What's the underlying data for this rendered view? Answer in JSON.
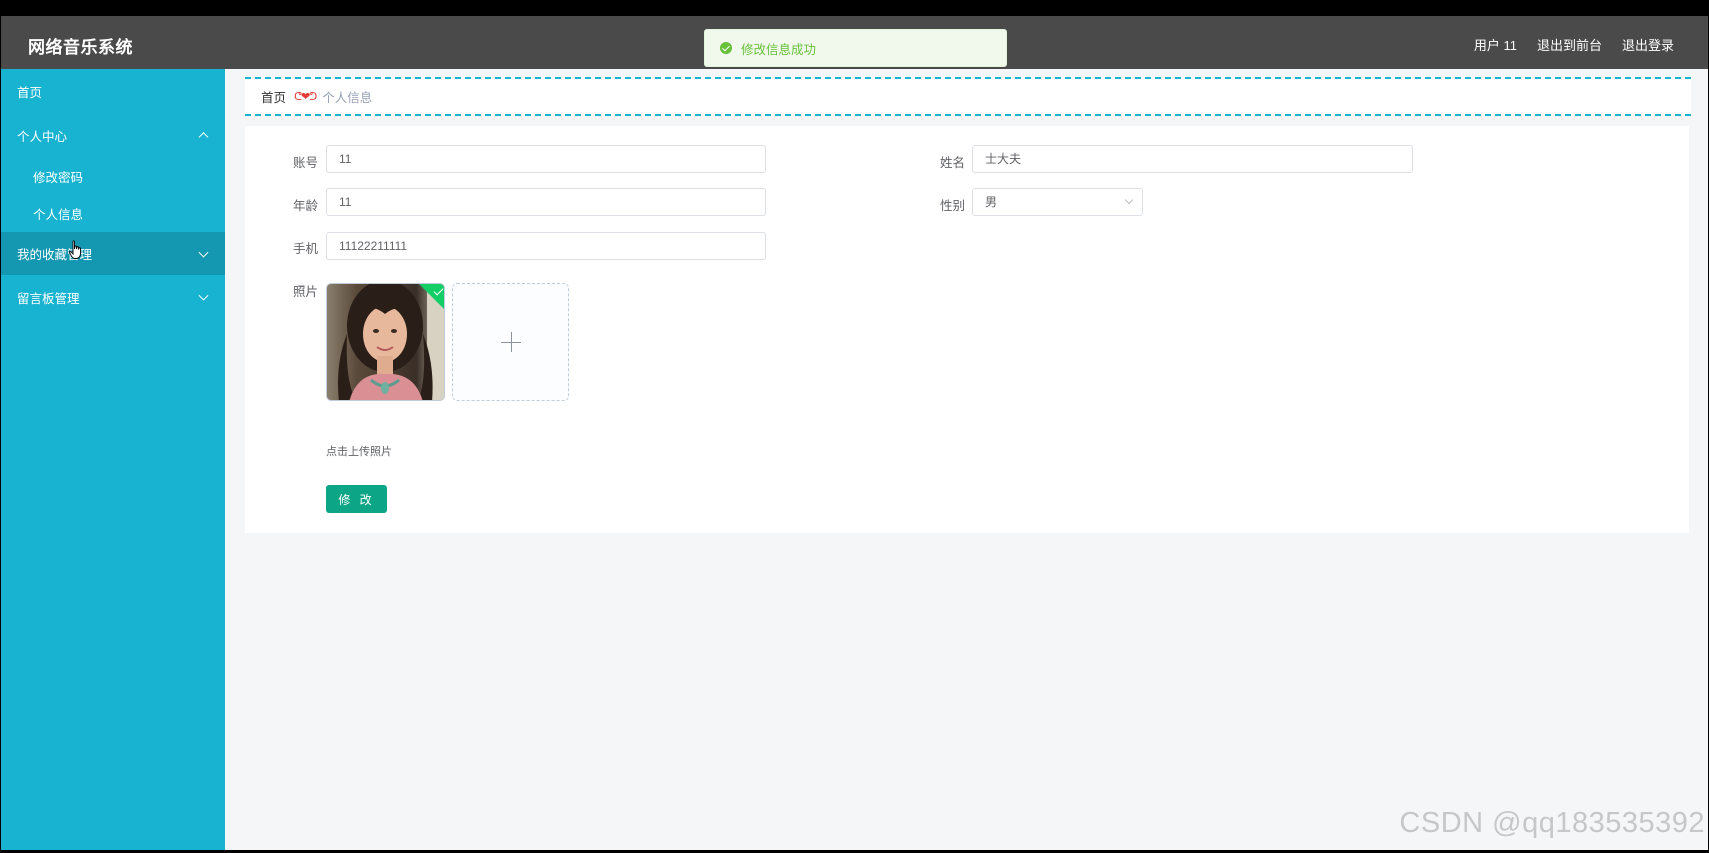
{
  "app": {
    "title": "网络音乐系统"
  },
  "header": {
    "user_label": "用户 11",
    "to_front": "退出到前台",
    "logout": "退出登录"
  },
  "toast": {
    "message": "修改信息成功"
  },
  "sidebar": {
    "items": [
      {
        "label": "首页"
      },
      {
        "label": "个人中心"
      },
      {
        "label": "修改密码"
      },
      {
        "label": "个人信息"
      },
      {
        "label": "我的收藏管理"
      },
      {
        "label": "留言板管理"
      }
    ]
  },
  "breadcrumb": {
    "home": "首页",
    "separator": "ᕦ❤ᕤ",
    "current": "个人信息"
  },
  "form": {
    "account_label": "账号",
    "account_value": "11",
    "name_label": "姓名",
    "name_value": "士大夫",
    "age_label": "年龄",
    "age_value": "11",
    "gender_label": "性别",
    "gender_value": "男",
    "phone_label": "手机",
    "phone_value": "11122211111",
    "photo_label": "照片",
    "upload_tip": "点击上传照片",
    "submit_label": "修 改"
  },
  "watermark": "CSDN @qq183535392",
  "colors": {
    "sidebar": "#17b3d0",
    "topbar": "#4a4a4a",
    "button": "#0ca585",
    "success": "#67c23a"
  }
}
